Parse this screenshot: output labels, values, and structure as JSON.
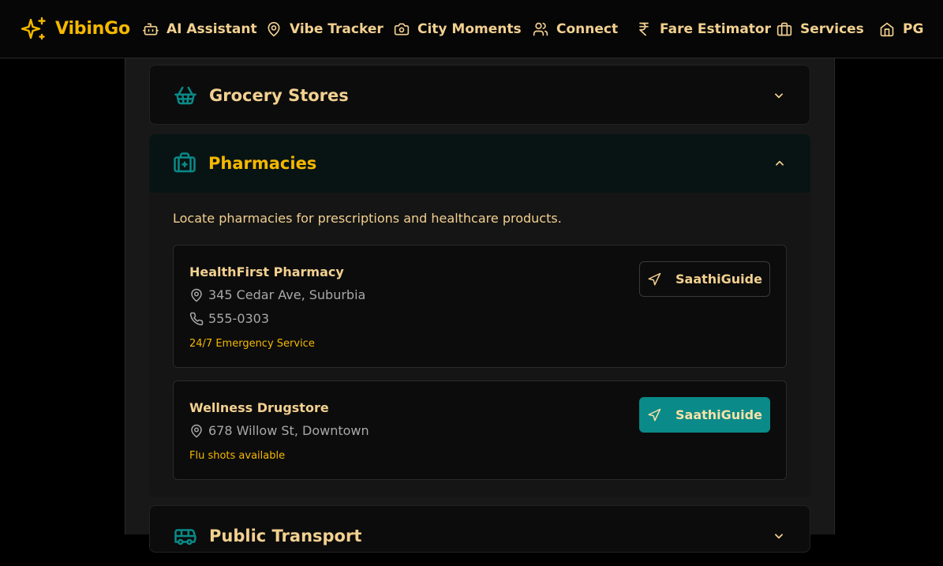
{
  "brand": {
    "name": "VibinGo",
    "color": "#f5b800",
    "icon": "sparkles-icon"
  },
  "nav": {
    "items": [
      {
        "label": "AI Assistant",
        "icon": "bot-icon"
      },
      {
        "label": "Vibe Tracker",
        "icon": "map-pin-icon"
      },
      {
        "label": "City Moments",
        "icon": "camera-icon"
      },
      {
        "label": "Connect",
        "icon": "users-icon"
      },
      {
        "label": "Fare Estimator",
        "icon": "rupee-icon"
      },
      {
        "label": "Services",
        "icon": "briefcase-icon"
      },
      {
        "label": "PG",
        "icon": "home-icon"
      }
    ]
  },
  "sections": {
    "grocery": {
      "title": "Grocery Stores",
      "icon": "shopping-basket-icon",
      "expanded": false
    },
    "pharmacies": {
      "title": "Pharmacies",
      "icon": "medical-briefcase-icon",
      "expanded": true,
      "description": "Locate pharmacies for prescriptions and healthcare products.",
      "items": [
        {
          "name": "HealthFirst Pharmacy",
          "address": "345 Cedar Ave, Suburbia",
          "phone": "555-0303",
          "note": "24/7 Emergency Service",
          "button": "SaathiGuide"
        },
        {
          "name": "Wellness Drugstore",
          "address": "678 Willow St, Downtown",
          "note": "Flu shots available",
          "button": "SaathiGuide"
        }
      ]
    },
    "transport": {
      "title": "Public Transport",
      "icon": "bus-icon",
      "expanded": false
    }
  },
  "colors": {
    "accent": "#f5b800",
    "text": "#f2d090",
    "teal": "#0a8a88",
    "muted": "#a8a8a8"
  }
}
